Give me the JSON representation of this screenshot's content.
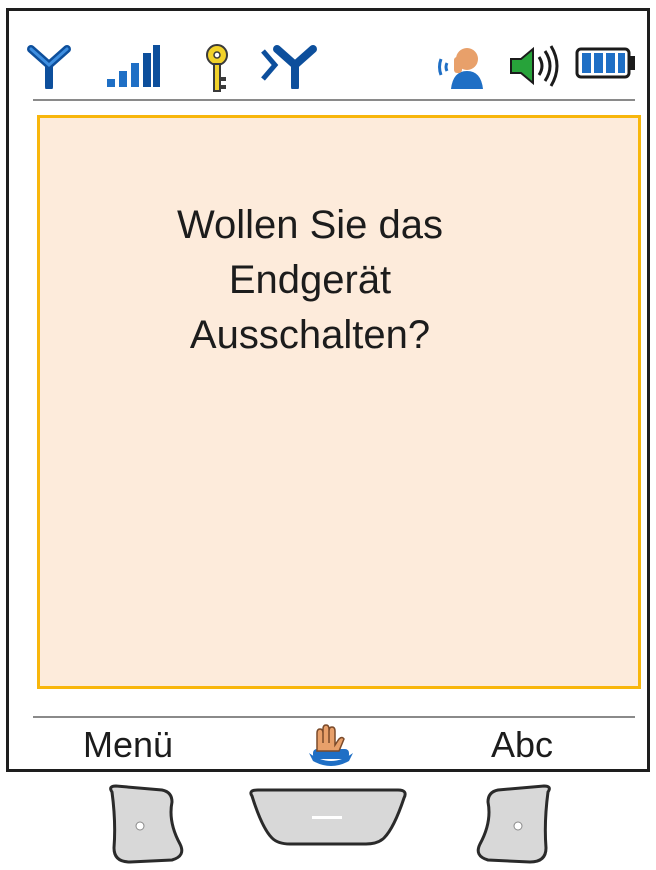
{
  "status_bar": {
    "icons": [
      "antenna-icon",
      "signal-strength-icon",
      "key-icon",
      "network-antenna-icon",
      "handset-caller-icon",
      "speaker-volume-icon",
      "battery-icon"
    ],
    "colors": {
      "icon_blue": "#1f6fc5",
      "key_yellow": "#f2d22a",
      "speaker_green": "#27a33a"
    }
  },
  "dialog": {
    "message": "Wollen Sie das\nEndgerät\nAusschalten?",
    "colors": {
      "background": "#fdebdb",
      "border": "#f8b60c"
    }
  },
  "softkeys": {
    "left_label": "Menü",
    "center_icon": "hand-on-key-icon",
    "right_label": "Abc"
  },
  "hardware_keys": [
    "left-softkey",
    "center-navigation-key",
    "right-softkey"
  ]
}
